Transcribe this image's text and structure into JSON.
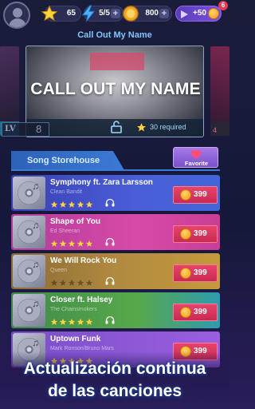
{
  "topbar": {
    "stars": "65",
    "energy": "5/5",
    "coins": "800",
    "ad_reward": "+50",
    "ad_badge": "6"
  },
  "carousel": {
    "section_title": "Call Out My Name",
    "hero_title": "CALL OUT MY NAME",
    "required": "30 required",
    "left_level_label": "LV",
    "left_level_value": "8",
    "right_label": "4"
  },
  "store": {
    "header": "Song Storehouse",
    "favorite_label": "Favorite"
  },
  "songs": [
    {
      "title": "Symphony ft. Zara Larsson",
      "artist": "Clean Bandit",
      "rating": 5,
      "price": "399"
    },
    {
      "title": "Shape of You",
      "artist": "Ed Sheeran",
      "rating": 5,
      "price": "399"
    },
    {
      "title": "We Will Rock You",
      "artist": "Queen",
      "rating": 0,
      "price": "399"
    },
    {
      "title": "Closer ft. Halsey",
      "artist": "The Chainsmokers",
      "rating": 5,
      "price": "399"
    },
    {
      "title": "Uptown Funk",
      "artist": "Mark Ronson/Bruno Mars",
      "rating": 5,
      "price": "399"
    }
  ],
  "caption": {
    "line1": "Actualización continua",
    "line2": "de las canciones"
  },
  "colors": {
    "accent_blue": "#3c7ad6",
    "price_red": "#e8446a",
    "star_gold": "#ffd23f",
    "coin_orange": "#f09a1a"
  },
  "icons": {
    "star": "star-icon",
    "energy": "lightning-icon",
    "coin": "coin-icon",
    "ad": "play-video-icon",
    "lock": "lock-icon",
    "favorite": "heart-icon",
    "headphones": "headphones-icon",
    "cover": "vinyl-disc-icon"
  }
}
